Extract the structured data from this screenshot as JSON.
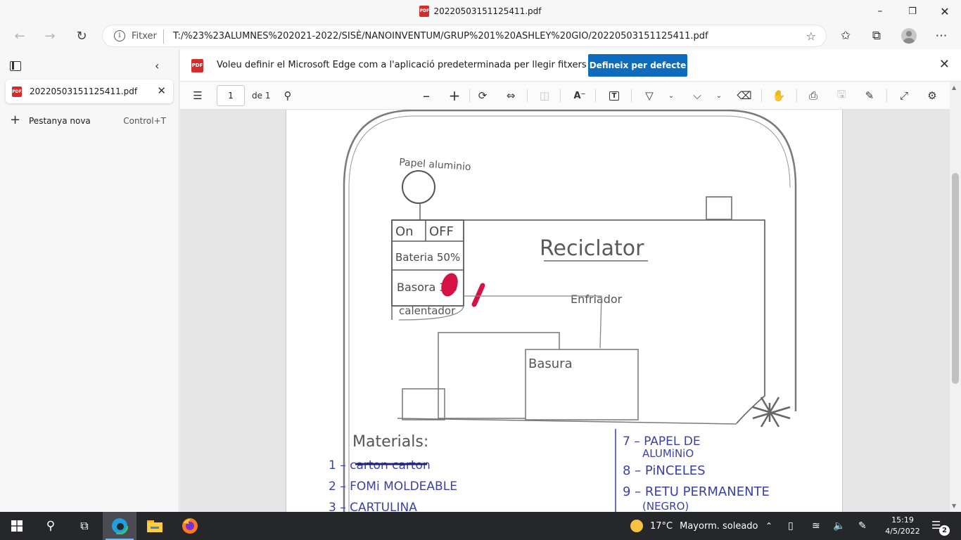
{
  "window": {
    "title": "20220503151125411.pdf",
    "minimize_icon": "minimize-icon",
    "maximize_icon": "restore-icon",
    "close_icon": "close-icon"
  },
  "address_bar": {
    "scheme_label": "Fitxer",
    "url": "T:/%23%23ALUMNES%202021-2022/SISÈ/NANOINVENTUM/GRUP%201%20ASHLEY%20GIO/20220503151125411.pdf"
  },
  "sidebar": {
    "tab": {
      "label": "20220503151125411.pdf"
    },
    "new_tab": {
      "label": "Pestanya nova",
      "shortcut": "Control+T"
    }
  },
  "infobar": {
    "message": "Voleu definir el Microsoft Edge com a l'aplicació predeterminada per llegir fitxers PDF?",
    "button": "Defineix per defecte"
  },
  "pdf_toolbar": {
    "page_current": "1",
    "page_of": "de 1"
  },
  "document": {
    "paper_label": "Papel aluminio",
    "on_label": "On",
    "off_label": "OFF",
    "battery_label": "Bateria 50%",
    "basura_pct_label": "Basora 3%",
    "calentador_label": "calentador",
    "title": "Reciclator",
    "enfriador_label": "Enfriador",
    "basura_label": "Basura",
    "materials_title": "Materials:",
    "materials_left": [
      "1 – carton   carton",
      "2 – FOMi MOLDEABLE",
      "3 – CARTULINA"
    ],
    "materials_right": [
      "7 – PAPEL DE",
      "ALUMiNiO",
      "8 – PiNCELES",
      "9 – RETU PERMANENTE",
      "(NEGRO)"
    ]
  },
  "taskbar": {
    "weather_temp": "17°C",
    "weather_desc": "Mayorm. soleado",
    "time": "15:19",
    "date": "4/5/2022",
    "notifications": "2"
  },
  "colors": {
    "accent": "#0f6cbd",
    "pdf_red": "#d42b2b",
    "pencil": "#6a6a6a",
    "ink_blue": "#3b3fa8",
    "marker_red": "#d41245"
  }
}
